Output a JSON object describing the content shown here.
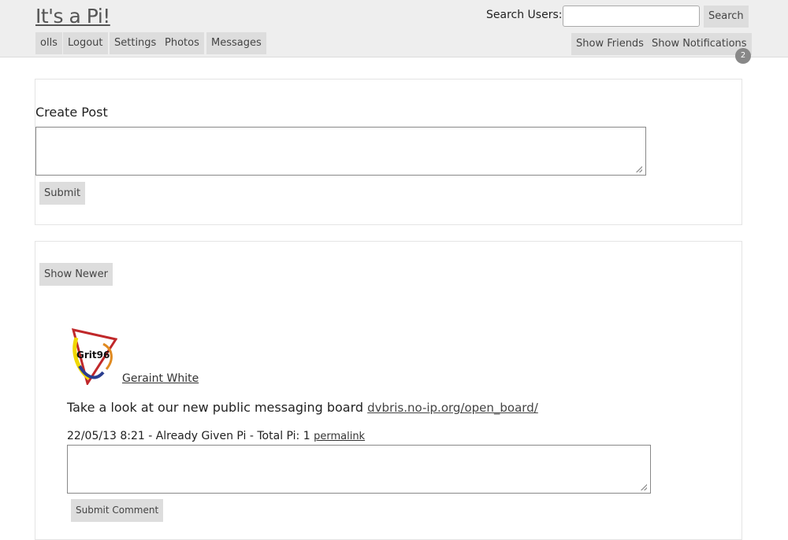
{
  "header": {
    "site_title": "It's a Pi!",
    "search_label": "Search Users:",
    "search_value": "",
    "search_button": "Search",
    "nav": [
      "olls",
      "Logout",
      "Settings",
      "Photos",
      "Messages"
    ],
    "show_friends": "Show Friends",
    "show_notifications": "Show Notifications",
    "notification_count": "2"
  },
  "create_post": {
    "title": "Create Post",
    "value": "",
    "submit_label": "Submit"
  },
  "feed": {
    "show_newer_label": "Show Newer",
    "post": {
      "avatar_text": "Grit96",
      "author": "Geraint White",
      "text": "Take a look at our new public messaging board",
      "link": "dvbris.no-ip.org/open_board/",
      "meta": "22/05/13 8:21 - Already Given Pi - Total Pi: 1",
      "permalink": "permalink",
      "comment_value": "",
      "submit_comment_label": "Submit Comment"
    }
  },
  "colors": {
    "header_bg": "#eeeeee",
    "button_bg": "#dddddd",
    "badge_bg": "#888888"
  }
}
